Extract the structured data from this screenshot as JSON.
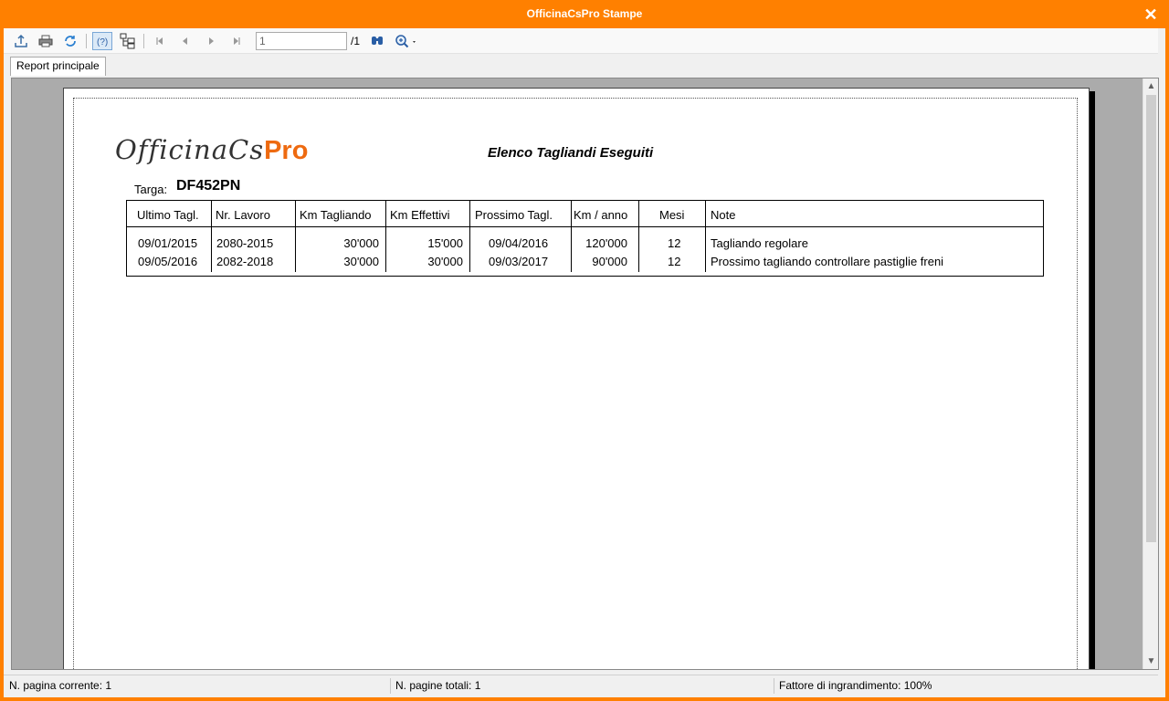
{
  "window": {
    "title": "OfficinaCsPro Stampe"
  },
  "toolbar": {
    "page_value": "1",
    "page_total": "/1"
  },
  "tabs": [
    {
      "label": "Report principale"
    }
  ],
  "report": {
    "logo_part1": "OfficinaCs",
    "logo_part2": "Pro",
    "title": "Elenco Tagliandi Eseguiti",
    "targa_label": "Targa:",
    "targa_value": "DF452PN",
    "columns": [
      "Ultimo Tagl.",
      "Nr. Lavoro",
      "Km Tagliando",
      "Km Effettivi",
      "Prossimo Tagl.",
      "Km / anno",
      "Mesi",
      "Note"
    ],
    "rows": [
      [
        "09/01/2015",
        "2080-2015",
        "30'000",
        "15'000",
        "09/04/2016",
        "120'000",
        "12",
        "Tagliando regolare"
      ],
      [
        "09/05/2016",
        "2082-2018",
        "30'000",
        "30'000",
        "09/03/2017",
        "90'000",
        "12",
        "Prossimo tagliando controllare pastiglie freni"
      ]
    ]
  },
  "status": {
    "current_page": "N. pagina corrente: 1",
    "total_pages": "N. pagine totali: 1",
    "zoom": "Fattore di ingrandimento: 100%"
  },
  "colors": {
    "titlebar": "#ff8000",
    "logo_accent": "#ee6a10"
  }
}
